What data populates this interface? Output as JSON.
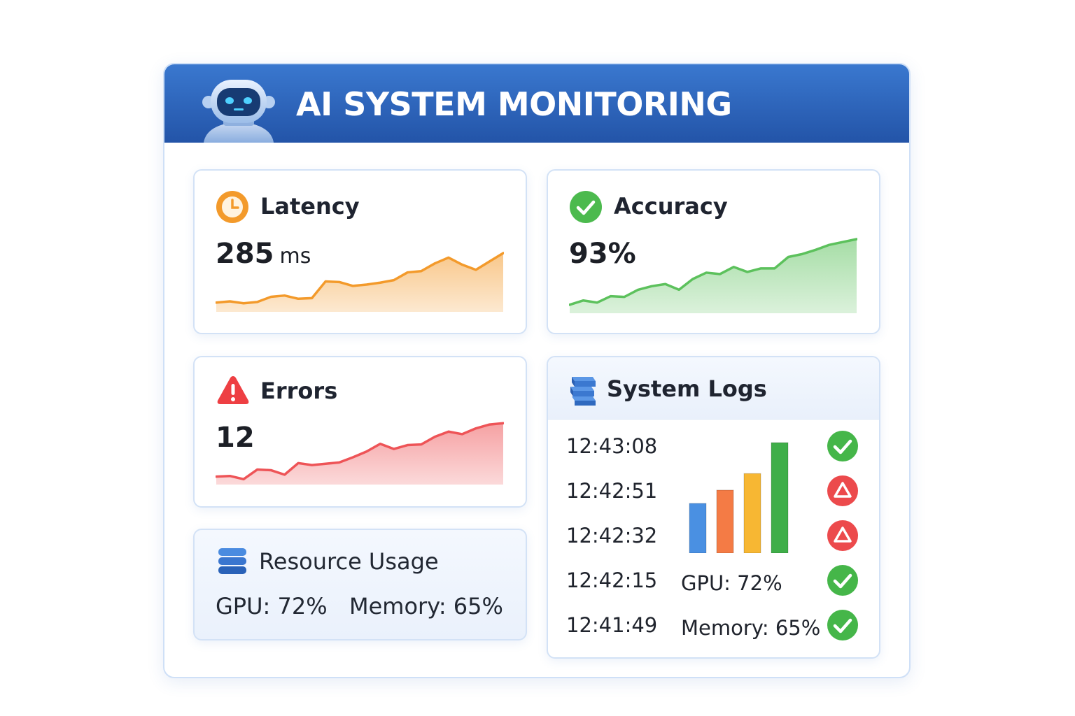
{
  "header": {
    "title": "AI SYSTEM MONITORING"
  },
  "latency": {
    "title": "Latency",
    "value": "285",
    "unit": "ms",
    "color": "#f39a2b",
    "trend": [
      10,
      12,
      9,
      11,
      19,
      21,
      16,
      17,
      43,
      42,
      36,
      38,
      41,
      45,
      57,
      59,
      71,
      80,
      69,
      61,
      74,
      87
    ]
  },
  "accuracy": {
    "title": "Accuracy",
    "value": "93%",
    "color": "#5cc15c",
    "trend": [
      8,
      14,
      11,
      20,
      19,
      29,
      34,
      37,
      29,
      44,
      53,
      51,
      61,
      54,
      59,
      59,
      75,
      79,
      85,
      92,
      96,
      100
    ]
  },
  "errors": {
    "title": "Errors",
    "value": "12",
    "color": "#ee5457",
    "trend": [
      8,
      9,
      4,
      19,
      18,
      11,
      29,
      26,
      28,
      30,
      38,
      47,
      59,
      51,
      57,
      58,
      70,
      78,
      74,
      83,
      89,
      91
    ]
  },
  "resources": {
    "title": "Resource Usage",
    "gpu_label": "GPU: 72%",
    "memory_label": "Memory: 65%"
  },
  "logs": {
    "title": "System Logs",
    "entries": [
      {
        "time": "12:43:08",
        "status": "ok"
      },
      {
        "time": "12:42:51",
        "status": "warning"
      },
      {
        "time": "12:42:32",
        "status": "warning"
      },
      {
        "time": "12:42:15",
        "status": "ok"
      },
      {
        "time": "12:41:49",
        "status": "ok"
      }
    ],
    "gpu_label": "GPU: 72%",
    "memory_label": "Memory: 65%",
    "bars": [
      {
        "value": 45,
        "color": "#4a90e2"
      },
      {
        "value": 57,
        "color": "#f47b45"
      },
      {
        "value": 72,
        "color": "#f7b733"
      },
      {
        "value": 100,
        "color": "#3fae49"
      }
    ]
  },
  "icons": {
    "header": "robot-icon",
    "latency": "clock-icon",
    "accuracy": "check-circle-icon",
    "errors": "warning-icon",
    "resources": "database-icon",
    "logs": "server-stack-icon",
    "status_ok": "check-circle-icon",
    "status_warning": "warning-circle-icon"
  }
}
